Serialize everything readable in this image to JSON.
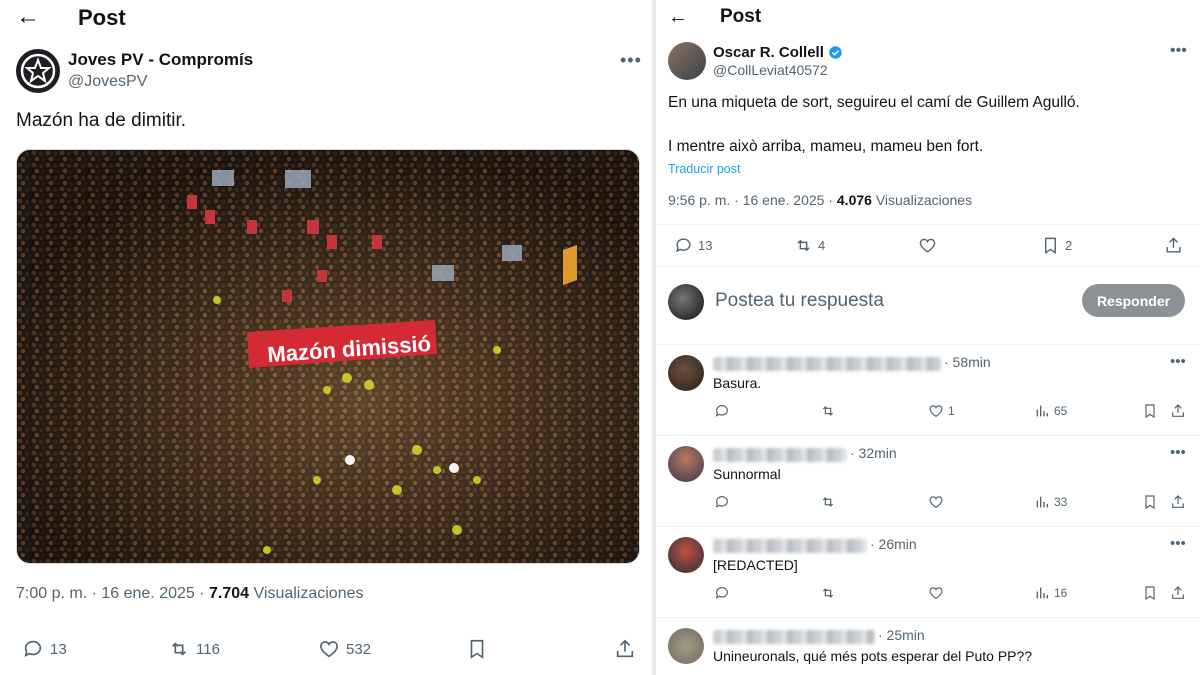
{
  "left": {
    "title": "Post",
    "author": {
      "name": "Joves PV - Compromís",
      "handle": "@JovesPV"
    },
    "text": "Mazón ha de dimitir.",
    "image": {
      "banner": "Mazón dimissió"
    },
    "meta": {
      "time": "7:00 p. m. · 16 ene. 2025 · ",
      "views": "7.704",
      "views_label": " Visualizaciones"
    },
    "actions": {
      "replies": "13",
      "reposts": "116",
      "likes": "532"
    }
  },
  "right": {
    "title": "Post",
    "author": {
      "name": "Oscar R. Collell",
      "handle": "@CollLeviat40572",
      "verified_color": "#1d9bf0"
    },
    "text_line1": "En una miqueta de sort, seguireu el camí de Guillem Agulló.",
    "text_line2": "I mentre això arriba, mameu, mameu ben fort.",
    "translate": "Traducir post",
    "meta": {
      "time": "9:56 p. m. · 16 ene. 2025 · ",
      "views": "4.076",
      "views_label": " Visualizaciones"
    },
    "actions": {
      "replies": "13",
      "reposts": "4",
      "likes": "",
      "bookmarks": "2"
    },
    "compose": {
      "placeholder": "Postea tu respuesta",
      "button": "Responder"
    },
    "replies": [
      {
        "time": "· 58min",
        "text": "Basura.",
        "likes": "1",
        "views": "65"
      },
      {
        "time": "· 32min",
        "text": "Sunnormal",
        "likes": "",
        "views": "33"
      },
      {
        "time": "· 26min",
        "text": "[REDACTED]",
        "likes": "",
        "views": "16"
      },
      {
        "time": "· 25min",
        "text": "Unineuronals, qué més pots esperar del Puto PP??",
        "likes": "",
        "views": ""
      }
    ]
  },
  "colors": {
    "accent": "#1d9bf0",
    "muted": "#536471",
    "banner_red": "#d42a35"
  }
}
